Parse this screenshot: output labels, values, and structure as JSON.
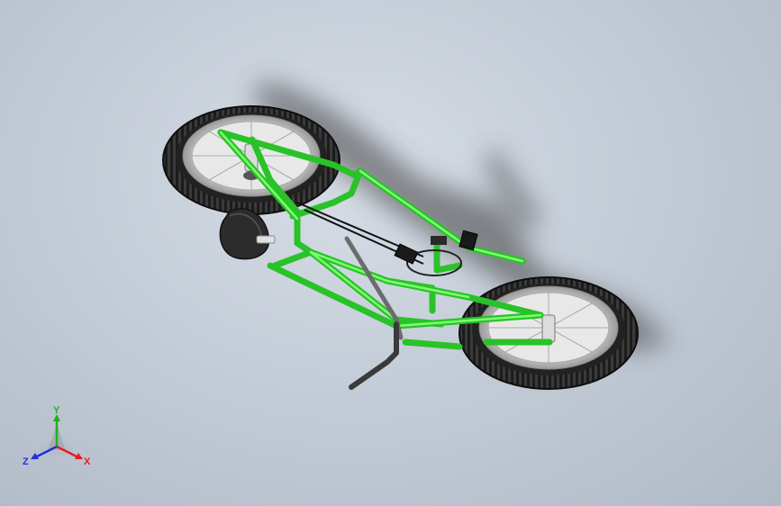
{
  "viewport": {
    "background_color": "#c4ccd7",
    "model_color": "#35dd35",
    "tire_color": "#1a1a1a"
  },
  "model": {
    "parts": [
      "front-wheel",
      "rear-wheel",
      "frame",
      "seat",
      "handlebar",
      "chain",
      "pedals"
    ]
  },
  "triad": {
    "x_label": "X",
    "y_label": "Y",
    "z_label": "Z",
    "x_color": "#e02020",
    "y_color": "#20b020",
    "z_color": "#2030e0"
  }
}
